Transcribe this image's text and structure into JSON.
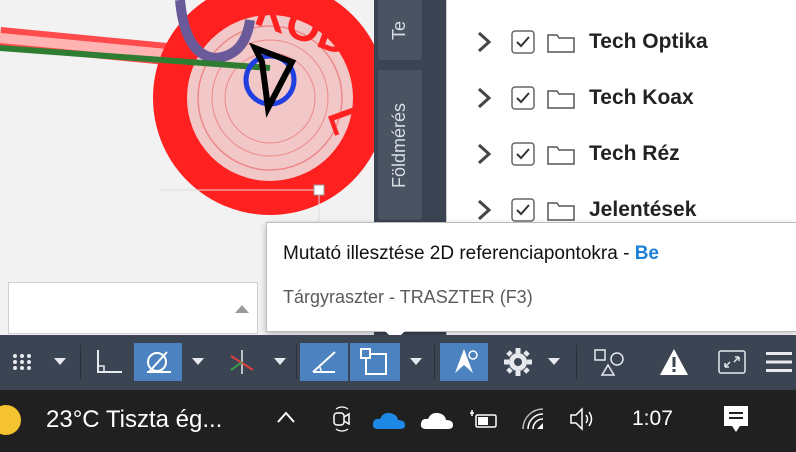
{
  "side_tabs": [
    "Te",
    "Földmérés"
  ],
  "tree_items": [
    {
      "label": "Tech Optika",
      "checked": true
    },
    {
      "label": "Tech Koax",
      "checked": true
    },
    {
      "label": "Tech Réz",
      "checked": true
    },
    {
      "label": "Jelentések",
      "checked": true
    }
  ],
  "tooltip": {
    "title": "Mutató illesztése 2D referenciapontokra",
    "separator": " - ",
    "state": "Be",
    "detail": "Tárgyraszter - TRASZTER (F3)"
  },
  "status_icons": [
    "grid-icon",
    "ortho-icon",
    "polar-icon",
    "isometric-icon",
    "object-snap-tracking-icon",
    "object-snap-icon",
    "annotation-scale-icon",
    "settings-icon",
    "selection-cycling-icon",
    "warning-icon",
    "fullscreen-icon",
    "menu-icon"
  ],
  "taskbar": {
    "temperature": "23°C",
    "weather": "Tiszta ég...",
    "time": "1:07"
  },
  "colors": {
    "accent": "#4d82c0",
    "status_bg": "#3b4453",
    "taskbar_bg": "#202020",
    "tooltip_state": "#1a7fd6"
  }
}
